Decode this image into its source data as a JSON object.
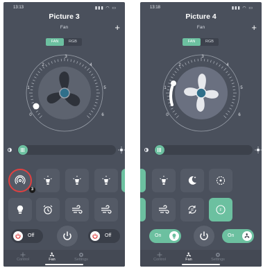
{
  "colors": {
    "background": "#4a505c",
    "accent": "#6cc0a0",
    "highlight": "#e04040"
  },
  "screen1": {
    "time": "13:13",
    "title": "Picture 3",
    "subtitle": "Fan",
    "mode_tabs": [
      "FAN",
      "RGB"
    ],
    "active_tab": "FAN",
    "dial_ticks": [
      "0",
      "1",
      "2",
      "3",
      "4",
      "5",
      "6"
    ],
    "fan_speed_level": 0,
    "brightness_fraction": 0.05,
    "scene_icons": [
      "nfc-icon",
      "lamp-icon",
      "lamp-icon",
      "lamp-icon",
      "bulb-icon",
      "alarm-icon",
      "wind-icon",
      "wind-icon"
    ],
    "highlighted_tile": "nfc-icon",
    "badge_number": "3",
    "light_power": {
      "label": "Off"
    },
    "fan_power": {
      "label": "Off"
    },
    "nav": [
      "Control",
      "Fan",
      "Settings"
    ],
    "active_nav": "Fan"
  },
  "screen2": {
    "time": "13:18",
    "title": "Picture 4",
    "subtitle": "Fan",
    "mode_tabs": [
      "FAN",
      "RGB"
    ],
    "active_tab": "FAN",
    "dial_ticks": [
      "0",
      "1",
      "2",
      "3",
      "4",
      "5",
      "6"
    ],
    "fan_speed_level": 1,
    "brightness_fraction": 0.05,
    "scene_icons": [
      "lamp-icon",
      "moon-icon",
      "rotate-icon",
      "wind-icon",
      "reverse-icon",
      "fan-mode-icon"
    ],
    "active_tile": "fan-mode-icon",
    "light_power": {
      "label": "On"
    },
    "fan_power": {
      "label": "On"
    },
    "nav": [
      "Control",
      "Fan",
      "Settings"
    ],
    "active_nav": "Fan"
  }
}
